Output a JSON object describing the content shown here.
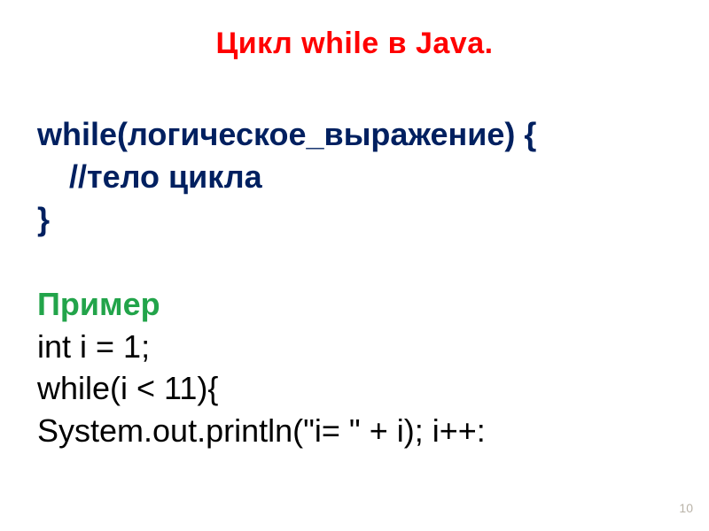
{
  "title": "Цикл while в Java.",
  "syntax": {
    "line1": "while(логическое_выражение) {",
    "line2": "//тело цикла",
    "line3": "}"
  },
  "example_label": "Пример",
  "example": {
    "line1": "int i = 1;",
    "line2": "while(i < 11){",
    "line3": "System.out.println(\"i= \" + i);    i++:"
  },
  "page_number": "10"
}
